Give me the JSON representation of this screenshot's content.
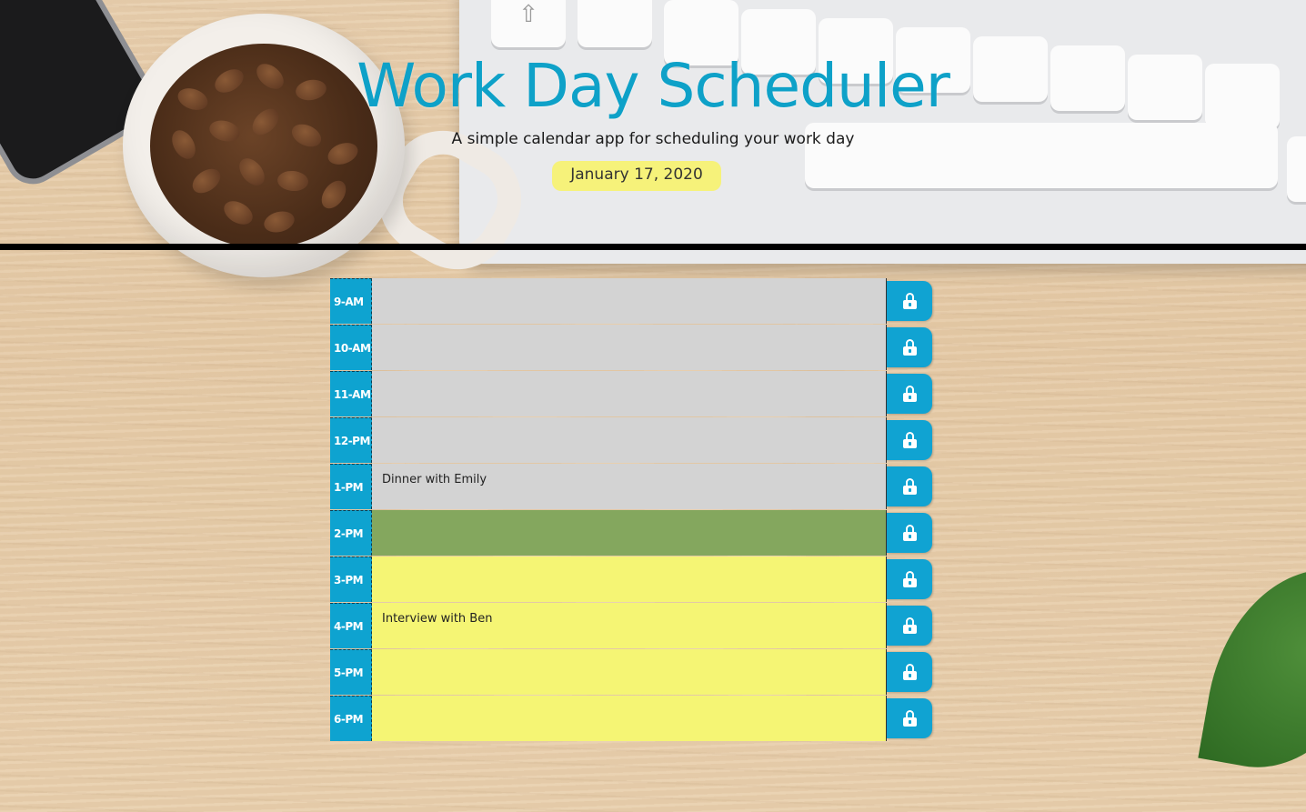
{
  "header": {
    "title": "Work Day Scheduler",
    "subtitle": "A simple calendar app for scheduling your work day",
    "current_date": "January 17, 2020"
  },
  "colors": {
    "accent": "#0ea1c8",
    "past": "#d3d3d3",
    "present": "#84a75e",
    "future": "#f5f574",
    "date_badge": "#f6f27a"
  },
  "save_icon": "lock-icon",
  "rows": [
    {
      "hour": "9-AM",
      "text": "",
      "state": "past"
    },
    {
      "hour": "10-AM",
      "text": "",
      "state": "past"
    },
    {
      "hour": "11-AM",
      "text": "",
      "state": "past"
    },
    {
      "hour": "12-PM",
      "text": "",
      "state": "past"
    },
    {
      "hour": "1-PM",
      "text": "Dinner with Emily",
      "state": "past"
    },
    {
      "hour": "2-PM",
      "text": "",
      "state": "present"
    },
    {
      "hour": "3-PM",
      "text": "",
      "state": "future"
    },
    {
      "hour": "4-PM",
      "text": "Interview with Ben",
      "state": "future"
    },
    {
      "hour": "5-PM",
      "text": "",
      "state": "future"
    },
    {
      "hour": "6-PM",
      "text": "",
      "state": "future"
    }
  ]
}
